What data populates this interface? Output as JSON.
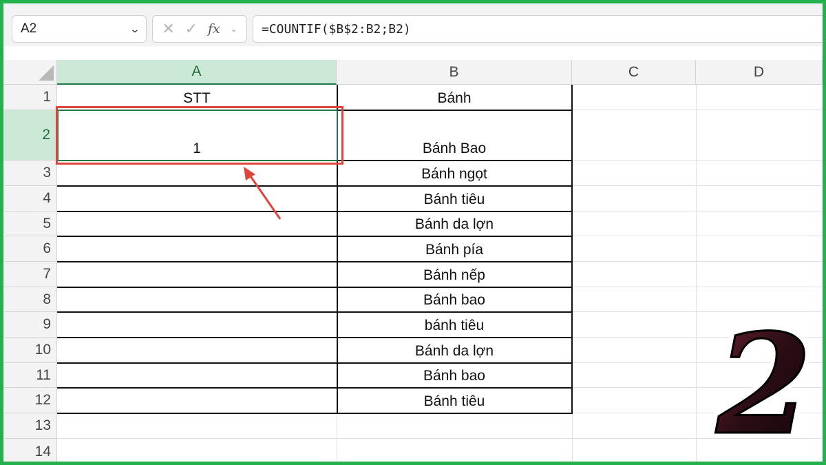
{
  "formula_bar": {
    "name_box": "A2",
    "cancel_icon": "✕",
    "enter_icon": "✓",
    "fx_label": "fx",
    "formula": "=COUNTIF($B$2:B2;B2)"
  },
  "columns": [
    "A",
    "B",
    "C",
    "D"
  ],
  "rows": [
    "1",
    "2",
    "3",
    "4",
    "5",
    "6",
    "7",
    "8",
    "9",
    "10",
    "11",
    "12",
    "13",
    "14"
  ],
  "table": {
    "header_a": "STT",
    "header_b": "Bánh",
    "a2_value": "1",
    "b_values": [
      "Bánh Bao",
      "Bánh ngọt",
      "Bánh tiêu",
      "Bánh da lợn",
      "Bánh pía",
      "Bánh nếp",
      "Bánh bao",
      "bánh tiêu",
      "Bánh da lợn",
      "Bánh bao",
      "Bánh tiêu"
    ]
  },
  "active_cell": "A2",
  "step_badge": "2",
  "colors": {
    "frame": "#22b14c",
    "highlight": "#e0443f",
    "active_header": "#cce8d6"
  }
}
